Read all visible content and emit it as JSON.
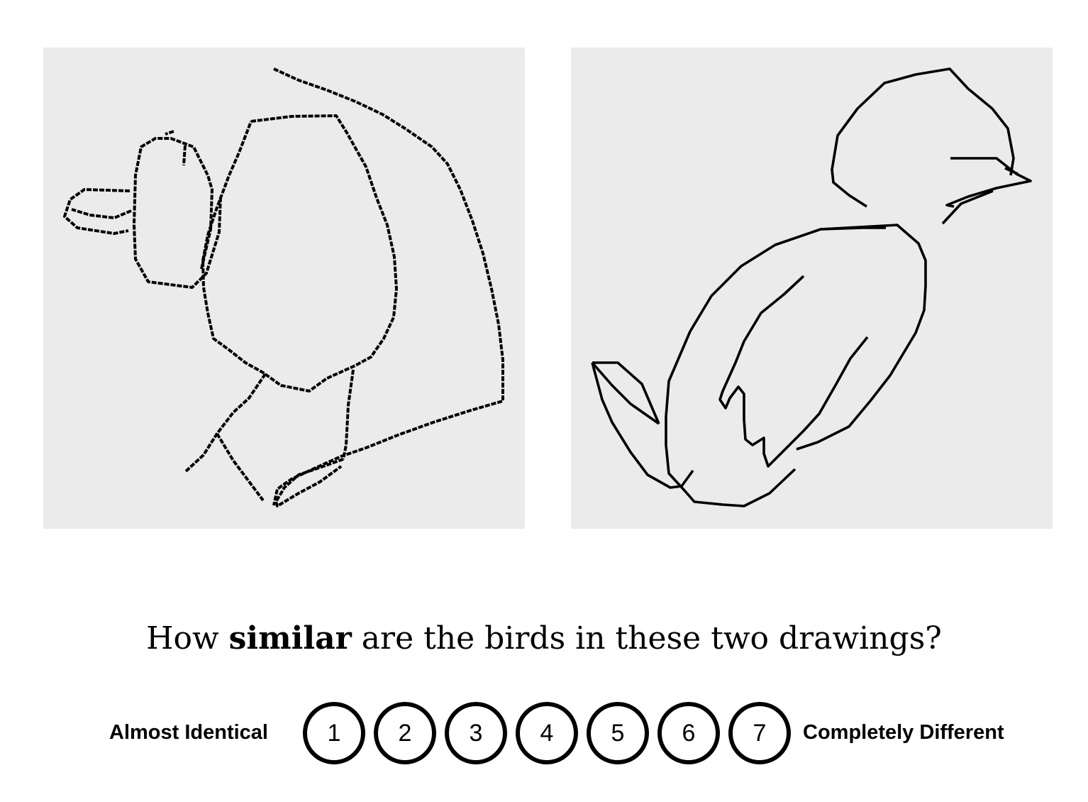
{
  "question": {
    "prefix": "How ",
    "emphasis": "similar",
    "suffix": " are the birds in these two drawings?"
  },
  "scale": {
    "left_label": "Almost Identical",
    "right_label": "Completely Different",
    "options": [
      "1",
      "2",
      "3",
      "4",
      "5",
      "6",
      "7"
    ]
  },
  "colors": {
    "panel_background": "#ebebeb",
    "stroke": "#000000",
    "page_background": "#ffffff"
  }
}
